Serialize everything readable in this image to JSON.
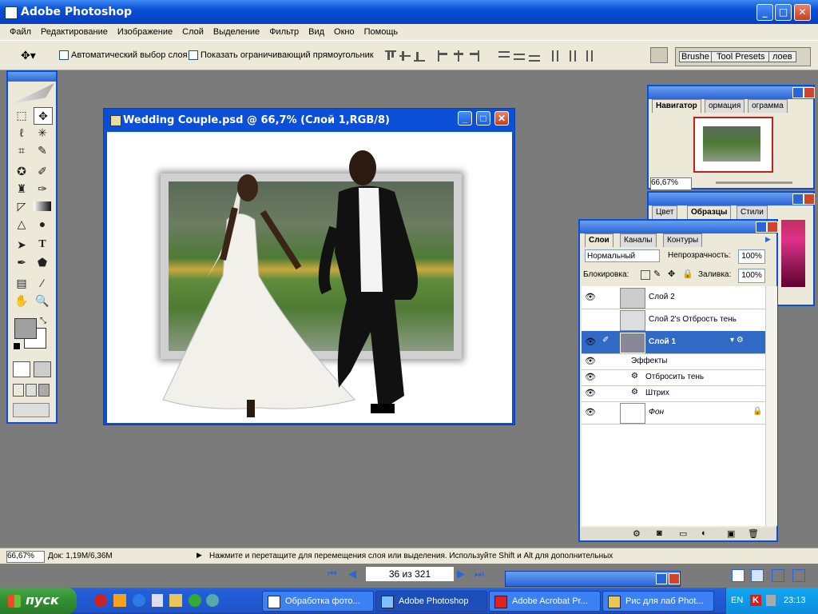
{
  "app": {
    "title": "Adobe Photoshop"
  },
  "menu": [
    "Файл",
    "Редактирование",
    "Изображение",
    "Слой",
    "Выделение",
    "Фильтр",
    "Вид",
    "Окно",
    "Помощь"
  ],
  "options": {
    "auto_select": "Автоматический выбор слоя",
    "show_bounds": "Показать ограничивающий прямоугольник",
    "well_tabs": [
      "Brushe",
      "Tool Presets",
      "лоев"
    ]
  },
  "document": {
    "title": "Wedding Couple.psd @ 66,7% (Слой 1,RGB/8)"
  },
  "navigator": {
    "tabs": [
      "Навигатор",
      "ормация",
      "ограмма"
    ],
    "zoom": "66,67%"
  },
  "swatches": {
    "tabs": [
      "Цвет",
      "Образцы",
      "Стили"
    ]
  },
  "layers": {
    "tabs": [
      "Слои",
      "Каналы",
      "Контуры"
    ],
    "blend_mode": "Нормальный",
    "opacity_label": "Непрозрачность:",
    "opacity_value": "100%",
    "lock_label": "Блокировка:",
    "fill_label": "Заливка:",
    "fill_value": "100%",
    "rows": [
      "Слой 2",
      "Слой 2's Отбрость тень",
      "Слой 1",
      "Эффекты",
      "Отбросить тень",
      "Штрих",
      "Фон"
    ]
  },
  "status": {
    "zoom": "66,67%",
    "doc": "Док: 1,19M/6,36M",
    "hint": "Нажмите и перетащите для перемещения слоя или выделения. Используйте Shift и Alt для дополнительных"
  },
  "pager": {
    "text": "36 из 321"
  },
  "taskbar": {
    "start": "пуск",
    "items": [
      "Обработка фото...",
      "Adobe Photoshop",
      "Adobe Acrobat Pr...",
      "Рис для лаб Phot..."
    ],
    "lang": "EN",
    "clock": "23:13"
  }
}
